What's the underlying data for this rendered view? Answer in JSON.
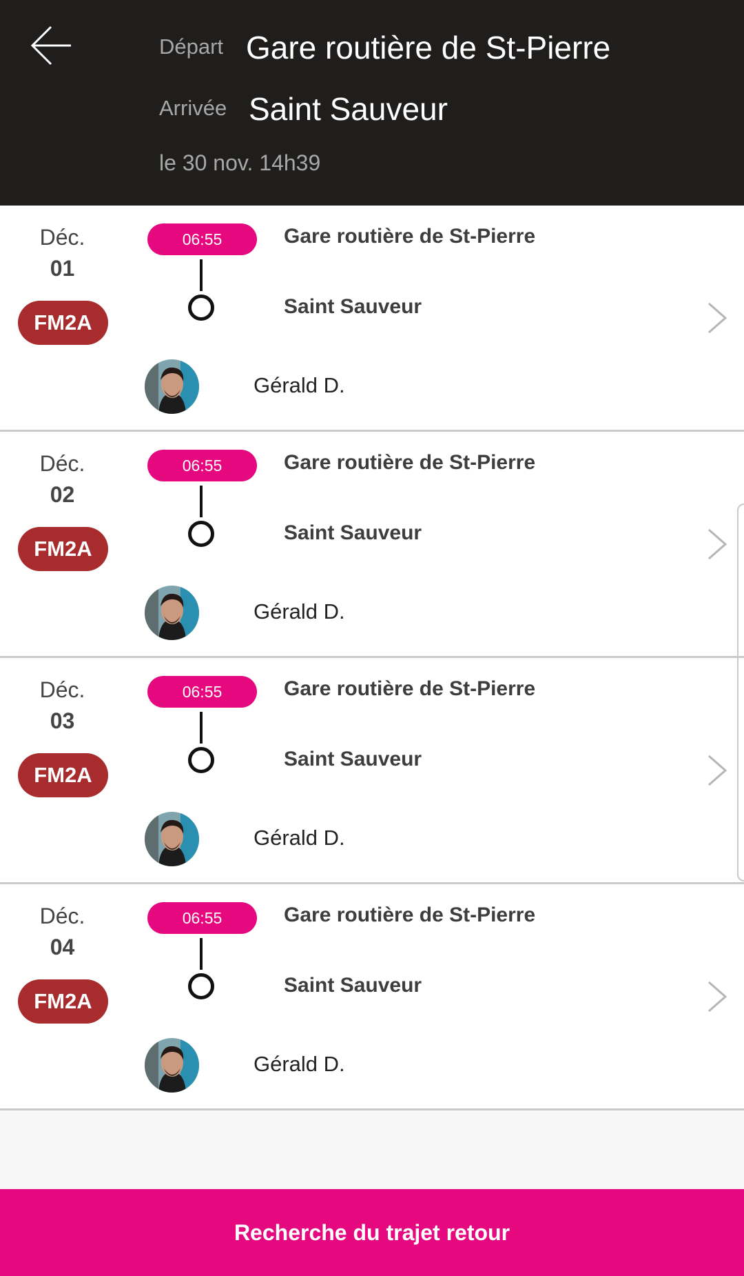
{
  "header": {
    "back_icon": "arrow-left-icon",
    "departure_label": "Départ",
    "departure_value": "Gare routière de St-Pierre",
    "arrival_label": "Arrivée",
    "arrival_value": "Saint Sauveur",
    "date": "le 30 nov. 14h39"
  },
  "trips": [
    {
      "month": "Déc.",
      "day": "01",
      "line": "FM2A",
      "time": "06:55",
      "from": "Gare routière de St-Pierre",
      "to": "Saint Sauveur",
      "driver": "Gérald D."
    },
    {
      "month": "Déc.",
      "day": "02",
      "line": "FM2A",
      "time": "06:55",
      "from": "Gare routière de St-Pierre",
      "to": "Saint Sauveur",
      "driver": "Gérald D."
    },
    {
      "month": "Déc.",
      "day": "03",
      "line": "FM2A",
      "time": "06:55",
      "from": "Gare routière de St-Pierre",
      "to": "Saint Sauveur",
      "driver": "Gérald D."
    },
    {
      "month": "Déc.",
      "day": "04",
      "line": "FM2A",
      "time": "06:55",
      "from": "Gare routière de St-Pierre",
      "to": "Saint Sauveur",
      "driver": "Gérald D."
    }
  ],
  "cta": {
    "label": "Recherche du trajet retour"
  },
  "colors": {
    "header_bg": "#1f1e1d",
    "accent": "#e6087e",
    "line_badge": "#a82b2e"
  }
}
